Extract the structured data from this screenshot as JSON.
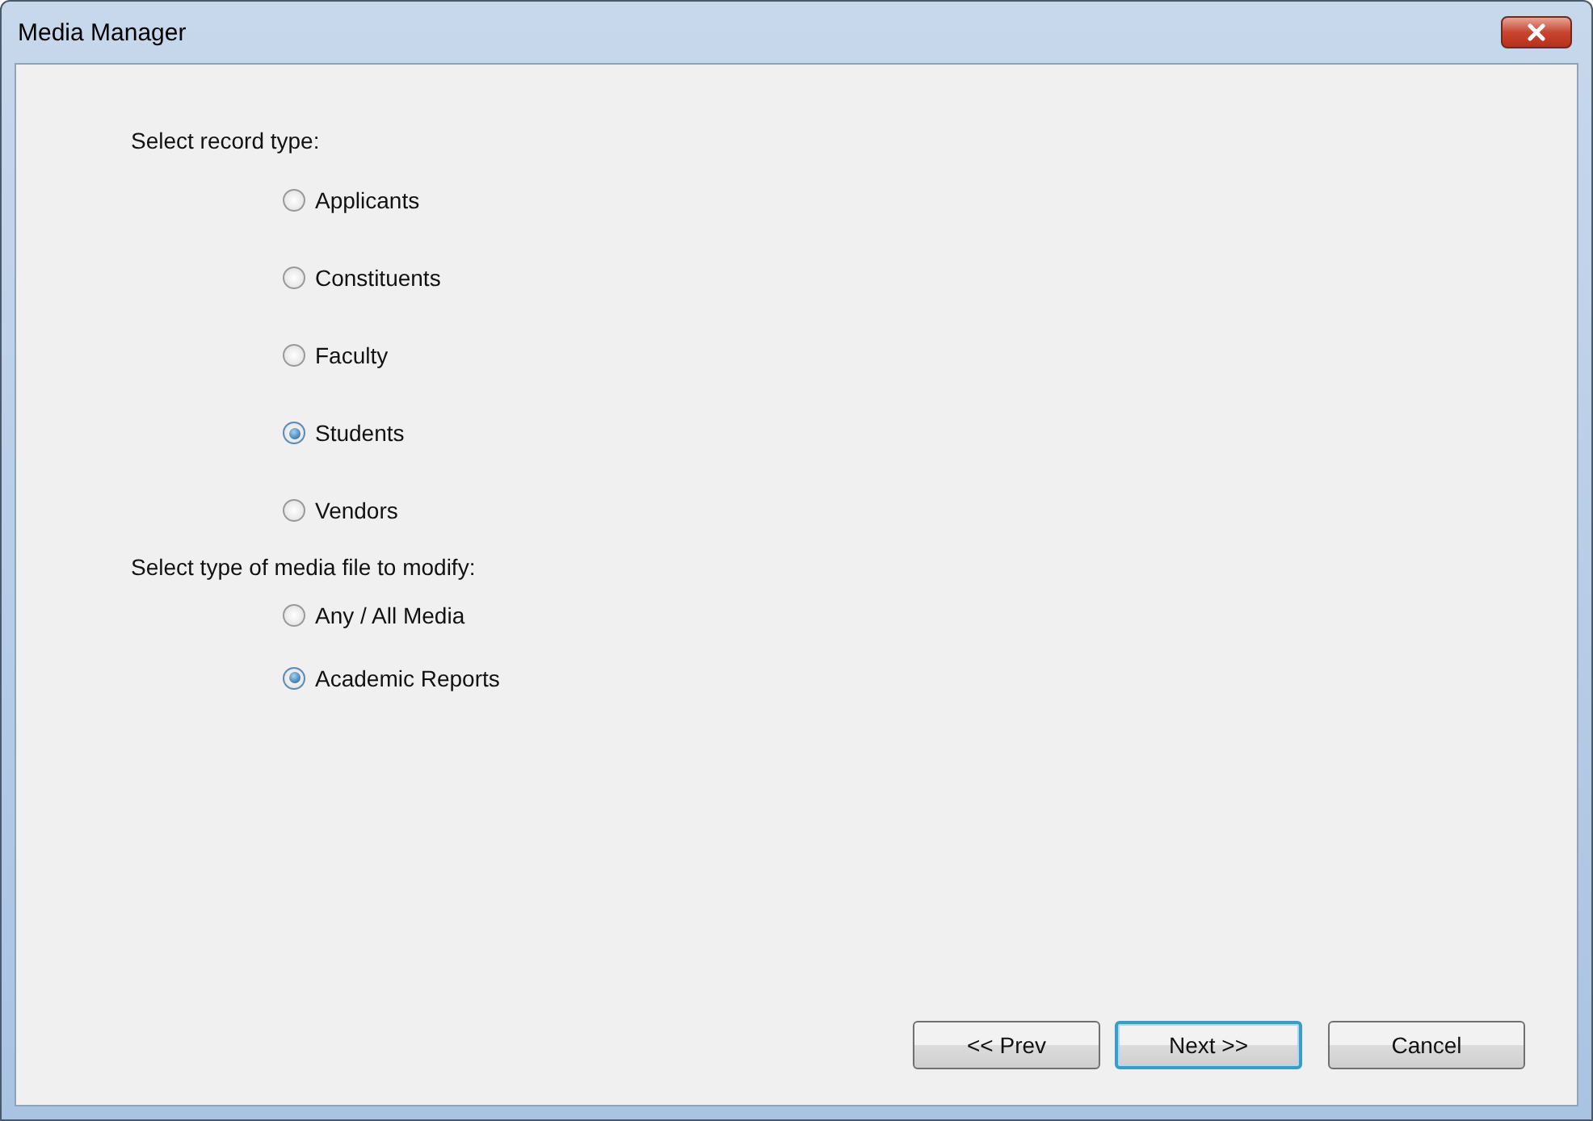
{
  "window": {
    "title": "Media Manager"
  },
  "record_type": {
    "label": "Select record type:",
    "options": [
      {
        "label": "Applicants",
        "selected": false
      },
      {
        "label": "Constituents",
        "selected": false
      },
      {
        "label": "Faculty",
        "selected": false
      },
      {
        "label": "Students",
        "selected": true
      },
      {
        "label": "Vendors",
        "selected": false
      }
    ]
  },
  "media_type": {
    "label": "Select type of media file to modify:",
    "options": [
      {
        "label": "Any / All Media",
        "selected": false
      },
      {
        "label": "Academic Reports",
        "selected": true
      }
    ]
  },
  "buttons": [
    {
      "label": "<< Prev",
      "default": false
    },
    {
      "label": "Next >>",
      "default": true
    },
    {
      "label": "Cancel",
      "default": false
    }
  ]
}
